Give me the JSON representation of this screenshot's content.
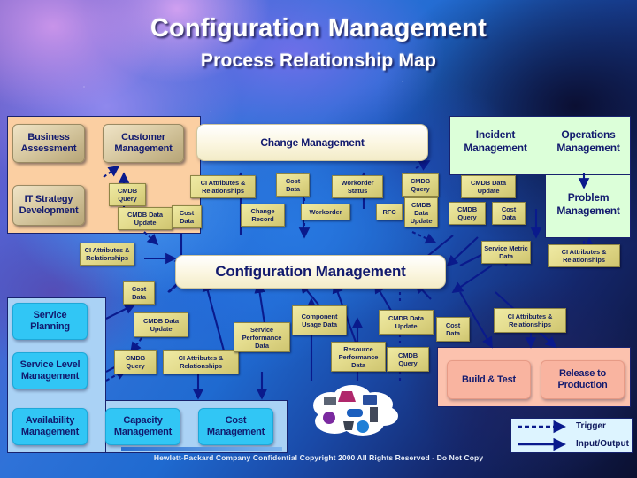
{
  "title": {
    "line1": "Configuration Management",
    "line2": "Process Relationship Map"
  },
  "groups": {
    "strategy": {
      "name": "business-strategy-group"
    },
    "service": {
      "name": "service-group"
    },
    "support": {
      "name": "support-group"
    },
    "release": {
      "name": "release-group"
    }
  },
  "processes": {
    "business_assessment": "Business Assessment",
    "it_strategy": "IT Strategy Development",
    "customer_management": "Customer Management",
    "change_management": "Change Management",
    "incident_management": "Incident Management",
    "operations_management": "Operations Management",
    "problem_management": "Problem Management",
    "configuration_management": "Configuration Management",
    "service_planning": "Service Planning",
    "service_level_management": "Service Level Management",
    "availability_management": "Availability Management",
    "capacity_management": "Capacity Management",
    "cost_management": "Cost Management",
    "build_and_test": "Build & Test",
    "release_to_production": "Release to Production"
  },
  "data_flows": [
    {
      "id": "d01",
      "label": "CMDB Query"
    },
    {
      "id": "d02",
      "label": "CMDB Data Update"
    },
    {
      "id": "d03",
      "label": "CI Attributes & Relationships"
    },
    {
      "id": "d04",
      "label": "Cost Data"
    },
    {
      "id": "d05",
      "label": "Cost Data"
    },
    {
      "id": "d06",
      "label": "Change Record"
    },
    {
      "id": "d07",
      "label": "Workorder Status"
    },
    {
      "id": "d08",
      "label": "Workorder"
    },
    {
      "id": "d09",
      "label": "RFC"
    },
    {
      "id": "d10",
      "label": "CMDB Query"
    },
    {
      "id": "d11",
      "label": "CMDB Data Update"
    },
    {
      "id": "d12",
      "label": "CMDB Data Update"
    },
    {
      "id": "d13",
      "label": "CMDB Query"
    },
    {
      "id": "d14",
      "label": "Cost Data"
    },
    {
      "id": "d15",
      "label": "CI Attributes & Relationships"
    },
    {
      "id": "d16",
      "label": "Cost Data"
    },
    {
      "id": "d17",
      "label": "Service Metric Data"
    },
    {
      "id": "d18",
      "label": "CI Attributes & Relationships"
    },
    {
      "id": "d19",
      "label": "CMDB Data Update"
    },
    {
      "id": "d20",
      "label": "CMDB Query"
    },
    {
      "id": "d21",
      "label": "CI Attributes & Relationships"
    },
    {
      "id": "d22",
      "label": "Service Performance Data"
    },
    {
      "id": "d23",
      "label": "Component Usage Data"
    },
    {
      "id": "d24",
      "label": "Resource Performance Data"
    },
    {
      "id": "d25",
      "label": "CMDB Data Update"
    },
    {
      "id": "d26",
      "label": "Cost Data"
    },
    {
      "id": "d27",
      "label": "CMDB Query"
    },
    {
      "id": "d28",
      "label": "CI Attributes & Relationships"
    }
  ],
  "legend": {
    "trigger": "Trigger",
    "input_output": "Input/Output"
  },
  "footer": "Hewlett-Packard Company Confidential Copyright 2000 All Rights Reserved - Do Not Copy",
  "colors": {
    "strategy_group": "#fbcfa2",
    "support_group": "#dcffd9",
    "service_group": "#aad2f5",
    "release_group": "#fcc2ae",
    "data_box": "#e3db8c",
    "arrow": "#0a1a8c",
    "text_dark": "#121a6e"
  }
}
